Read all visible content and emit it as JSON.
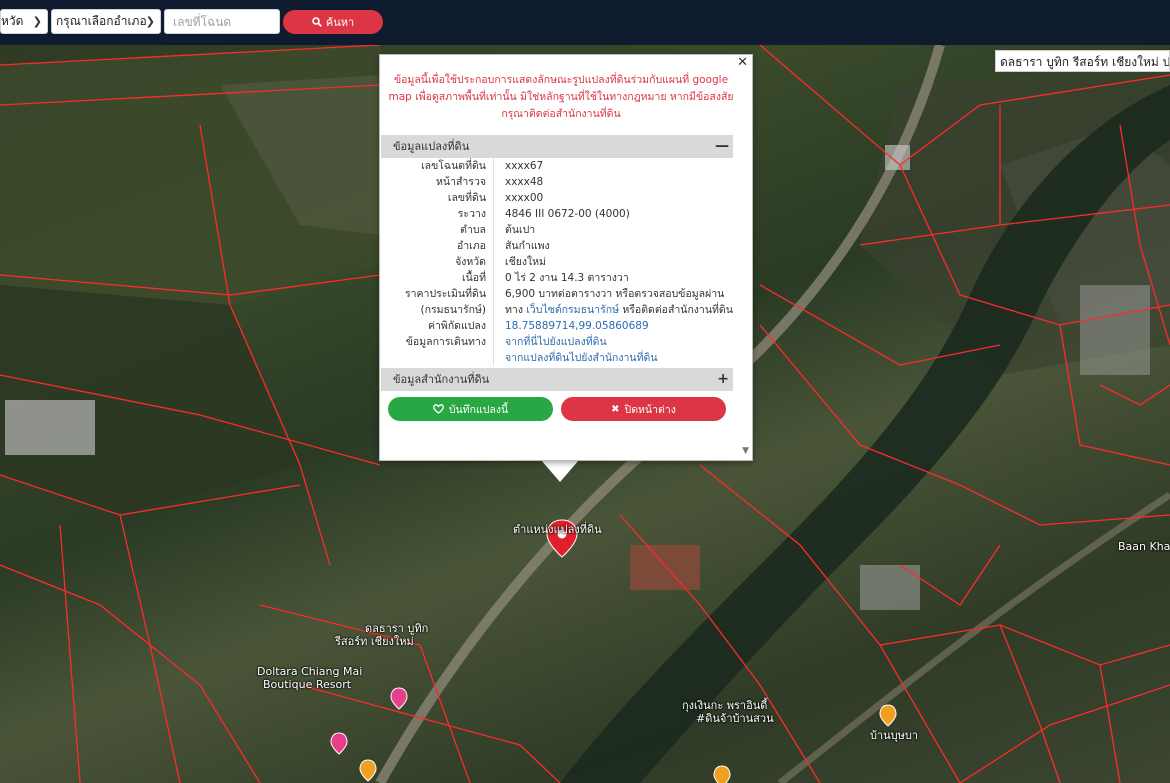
{
  "topbar": {
    "province_label": "หวัด",
    "district_placeholder": "กรุณาเลือกอำเภอ",
    "deed_placeholder": "เลขที่โฉนด",
    "search_label": "ค้นหา"
  },
  "map_search": {
    "value": "ดลธารา บูทิก รีสอร์ท เชียงใหม่ ปร"
  },
  "popup": {
    "disclaimer": "ข้อมูลนี้เพื่อใช้ประกอบการแสดงลักษณะรูปแปลงที่ดินร่วมกับแผนที่ google map เพื่อดูสภาพพื้นที่เท่านั้น มิใช่หลักฐานที่ใช้ในทางกฎหมาย หากมีข้อสงสัย กรุณาติดต่อสำนักงานที่ดิน",
    "section_land": "ข้อมูลแปลงที่ดิน",
    "section_office": "ข้อมูลสำนักงานที่ดิน",
    "rows": [
      {
        "label": "เลขโฉนดที่ดิน",
        "value": "xxxx67"
      },
      {
        "label": "หน้าสำรวจ",
        "value": "xxxx48"
      },
      {
        "label": "เลขที่ดิน",
        "value": "xxxx00"
      },
      {
        "label": "ระวาง",
        "value": "4846 III 0672-00 (4000)"
      },
      {
        "label": "ตำบล",
        "value": "ต้นเปา"
      },
      {
        "label": "อำเภอ",
        "value": "สันกำแพง"
      },
      {
        "label": "จังหวัด",
        "value": "เชียงใหม่"
      },
      {
        "label": "เนื้อที่",
        "value": "0 ไร่ 2 งาน 14.3 ตารางวา"
      },
      {
        "label": "ราคาประเมินที่ดิน",
        "value": "6,900 บาทต่อตารางวา หรือตรวจสอบข้อมูลผ่าน"
      }
    ],
    "dept": {
      "label": "(กรมธนารักษ์)",
      "prefix": "ทาง ",
      "link": "เว็บไซต์กรมธนารักษ์",
      "suffix": " หรือติดต่อสำนักงานที่ดิน"
    },
    "coord": {
      "label": "ค่าพิกัดแปลง",
      "value": "18.75889714,99.05860689"
    },
    "route": {
      "label": "ข้อมูลการเดินทาง",
      "link1": "จากที่นี่ไปยังแปลงที่ดิน",
      "link2": "จากแปลงที่ดินไปยังสำนักงานที่ดิน"
    },
    "save_label": "บันทึกแปลงนี้",
    "close_label": "ปิดหน้าต่าง"
  },
  "map_labels": {
    "marker": "ตำแหน่งแปลงที่ดิน",
    "resort_th_1": "ดลธารา บูทิก",
    "resort_th_2": "รีสอร์ท เชียงใหม่",
    "resort_en_1": "Doltara Chiang Mai",
    "resort_en_2": "Boutique Resort",
    "kungngern_1": "กุงเงินกะ พราอินดี้",
    "kungngern_2": "#ดินจ้าบ้านสวน",
    "banbuchaba": "บ้านบุษบา",
    "baankha": "Baan Kha"
  },
  "colors": {
    "accent_red": "#dc3545",
    "accent_green": "#28a745",
    "parcel_line": "#ff2a2a",
    "topbar": "#0f1b2e"
  }
}
